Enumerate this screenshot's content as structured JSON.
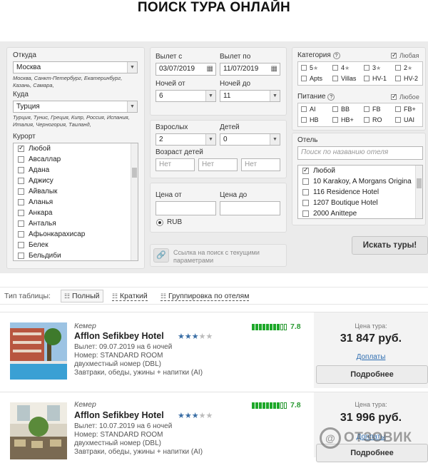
{
  "page": {
    "title": "ПОИСК ТУРА ОНЛАЙН"
  },
  "search": {
    "from": {
      "label": "Откуда",
      "value": "Москва",
      "hint": "Москва, Санкт-Петербург, Екатеринбург, Казань, Самара,"
    },
    "to": {
      "label": "Куда",
      "value": "Турция",
      "hint": "Турция, Тунис, Греция, Кипр, Россия, Испания, Италия, Черногория, Таиланд,"
    },
    "resort": {
      "label": "Курорт",
      "items": [
        "Любой",
        "Авсаллар",
        "Адана",
        "Аджису",
        "Айвалык",
        "Аланья",
        "Анкара",
        "Анталья",
        "Афьонкарахисар",
        "Белек",
        "Бельдиби"
      ]
    },
    "depart_from": {
      "label": "Вылет с",
      "value": "03/07/2019"
    },
    "depart_to": {
      "label": "Вылет по",
      "value": "11/07/2019"
    },
    "nights_from": {
      "label": "Ночей от",
      "value": "6"
    },
    "nights_to": {
      "label": "Ночей до",
      "value": "11"
    },
    "adults": {
      "label": "Взрослых",
      "value": "2"
    },
    "children": {
      "label": "Детей",
      "value": "0"
    },
    "child_age": {
      "label": "Возраст детей",
      "placeholders": [
        "Нет",
        "Нет",
        "Нет"
      ]
    },
    "price_from": {
      "label": "Цена от",
      "value": ""
    },
    "price_to": {
      "label": "Цена до",
      "value": ""
    },
    "currency": "RUB",
    "link_text": "Ссылка на поиск с текущими параметрами",
    "category": {
      "label": "Категория",
      "any": "Любая",
      "items": [
        "5",
        "4",
        "3",
        "2",
        "Apts",
        "Villas",
        "HV-1",
        "HV-2"
      ]
    },
    "meal": {
      "label": "Питание",
      "any": "Любое",
      "items": [
        "AI",
        "BB",
        "FB",
        "FB+",
        "HB",
        "HB+",
        "RO",
        "UAI"
      ]
    },
    "hotel": {
      "label": "Отель",
      "placeholder": "Поиск по названию отеля",
      "items": [
        "Любой",
        "10 Karakoy, A Morgans Origina",
        "116 Residence Hotel",
        "1207 Boutique Hotel",
        "2000 Anittepe"
      ]
    },
    "search_button": "Искать туры!"
  },
  "table_type": {
    "label": "Тип таблицы:",
    "options": [
      "Полный",
      "Краткий",
      "Группировка по отелям"
    ]
  },
  "results": [
    {
      "region": "Кемер",
      "name": "Afflon Sefikbey Hotel",
      "stars": "★★★",
      "stars_off": "★★",
      "rating": "7.8",
      "departure": "Вылет: 09.07.2019 на 6 ночей",
      "room": "Номер: STANDARD ROOM",
      "room_type": "двухместный номер (DBL)",
      "meal": "Завтраки, обеды, ужины + напитки (AI)",
      "price_label": "Цена тура:",
      "price": "31 847 руб.",
      "extra": "Доплаты",
      "more": "Подробнее"
    },
    {
      "region": "Кемер",
      "name": "Afflon Sefikbey Hotel",
      "stars": "★★★",
      "stars_off": "★★",
      "rating": "7.8",
      "departure": "Вылет: 10.07.2019 на 6 ночей",
      "room": "Номер: STANDARD ROOM",
      "room_type": "двухместный номер (DBL)",
      "meal": "Завтраки, обеды, ужины + напитки (AI)",
      "price_label": "Цена тура:",
      "price": "31 996 руб.",
      "extra": "Доплаты",
      "more": "Подробнее"
    }
  ],
  "watermark": "ОТЗОВИК"
}
